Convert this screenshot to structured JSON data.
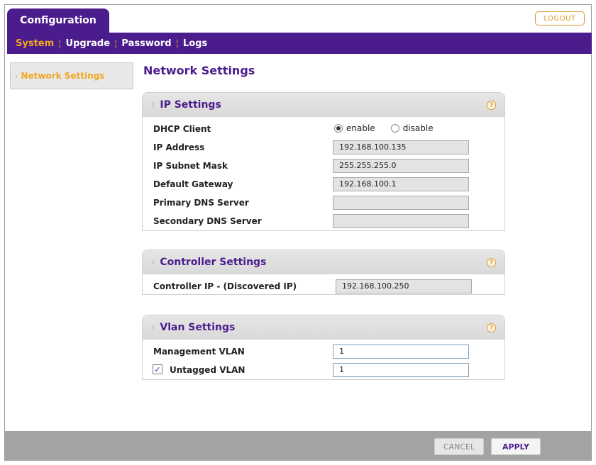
{
  "header": {
    "tab_label": "Configuration",
    "logout_label": "LOGOUT"
  },
  "menu": {
    "items": [
      {
        "label": "System",
        "active": true
      },
      {
        "label": "Upgrade",
        "active": false
      },
      {
        "label": "Password",
        "active": false
      },
      {
        "label": "Logs",
        "active": false
      }
    ]
  },
  "sidebar": {
    "items": [
      {
        "label": "Network Settings",
        "active": true
      }
    ]
  },
  "page": {
    "title": "Network Settings"
  },
  "ip_settings": {
    "title": "IP Settings",
    "dhcp": {
      "label": "DHCP Client",
      "enable_label": "enable",
      "disable_label": "disable",
      "selected": "enable"
    },
    "fields": [
      {
        "label": "IP Address",
        "value": "192.168.100.135"
      },
      {
        "label": "IP Subnet Mask",
        "value": "255.255.255.0"
      },
      {
        "label": "Default Gateway",
        "value": "192.168.100.1"
      },
      {
        "label": "Primary DNS Server",
        "value": ""
      },
      {
        "label": "Secondary DNS Server",
        "value": ""
      }
    ]
  },
  "controller_settings": {
    "title": "Controller Settings",
    "label": "Controller IP - (Discovered IP)",
    "value": "192.168.100.250"
  },
  "vlan_settings": {
    "title": "Vlan Settings",
    "management_label": "Management VLAN",
    "management_value": "1",
    "untagged_label": "Untagged VLAN",
    "untagged_checked": true,
    "untagged_value": "1"
  },
  "footer": {
    "cancel_label": "CANCEL",
    "apply_label": "APPLY"
  },
  "colors": {
    "brand_purple": "#4b1c8c",
    "accent_orange": "#f2a623"
  }
}
